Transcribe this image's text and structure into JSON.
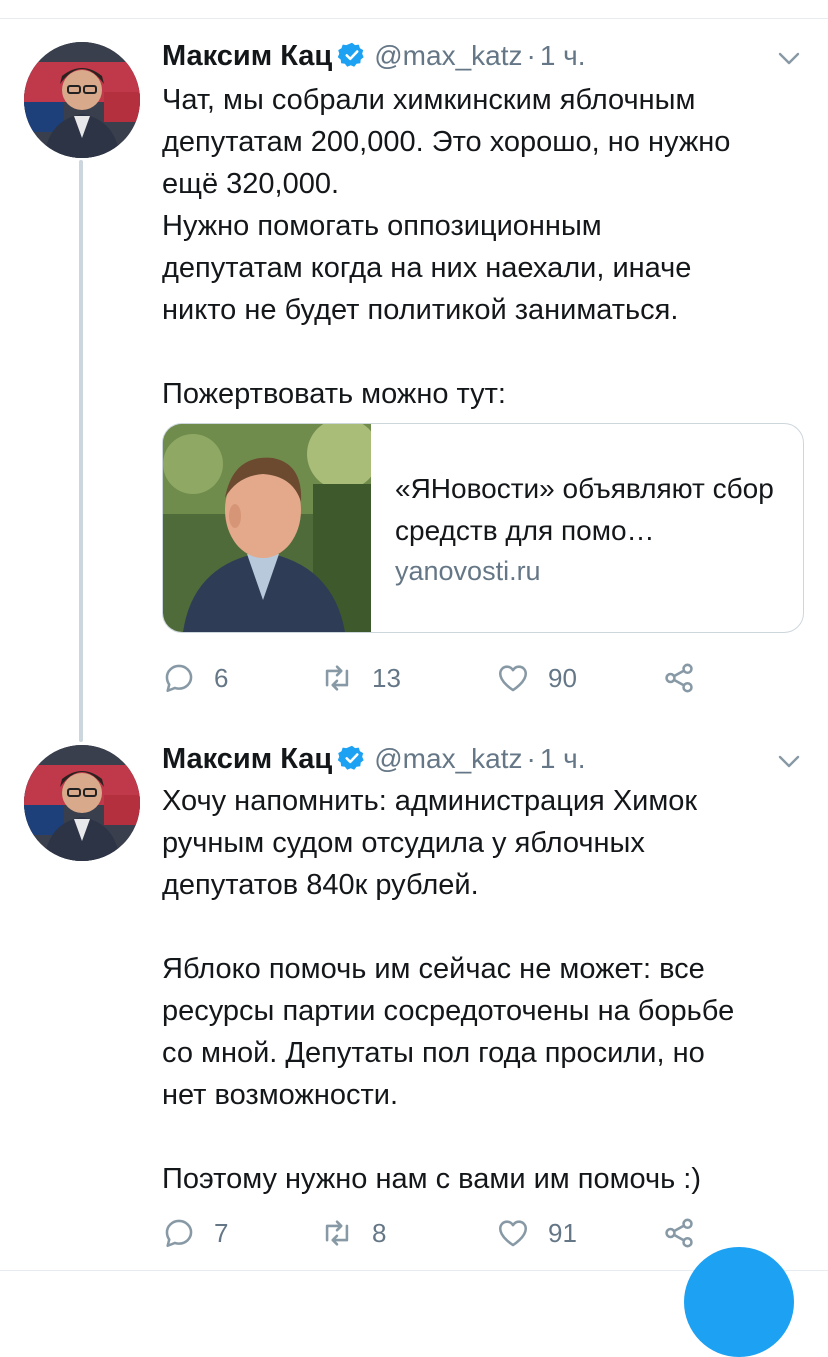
{
  "tweets": [
    {
      "author": {
        "name": "Максим Кац",
        "handle": "@max_katz",
        "time": "1 ч."
      },
      "text": "Чат, мы собрали химкинским яблочным\nдепутатам 200,000. Это хорошо, но нужно\nещё 320,000.\nНужно помогать оппозиционным\nдепутатам когда на них наехали, иначе\nникто не будет политикой заниматься.\n\nПожертвовать можно тут:",
      "card": {
        "title": "«ЯНовости» объявляют сбор средств для помо…",
        "domain": "yanovosti.ru"
      },
      "counts": {
        "replies": "6",
        "retweets": "13",
        "likes": "90"
      }
    },
    {
      "author": {
        "name": "Максим Кац",
        "handle": "@max_katz",
        "time": "1 ч."
      },
      "text": "Хочу напомнить: администрация Химок\nручным судом отсудила у яблочных\nдепутатов 840к рублей.\n\nЯблоко помочь им сейчас не может: все\nресурсы партии сосредоточены на борьбе\nсо мной. Депутаты пол года просили, но\nнет возможности.\n\nПоэтому нужно нам с вами им помочь :)",
      "counts": {
        "replies": "7",
        "retweets": "8",
        "likes": "91"
      }
    }
  ],
  "separator": "·",
  "icons": {
    "verified": "verified-badge-icon",
    "caret": "chevron-down-icon",
    "reply": "reply-icon",
    "retweet": "retweet-icon",
    "like": "heart-icon",
    "share": "share-icon"
  },
  "colors": {
    "accent": "#1da1f2",
    "text": "#14171a",
    "muted": "#657786",
    "border": "#ccd6dd"
  }
}
